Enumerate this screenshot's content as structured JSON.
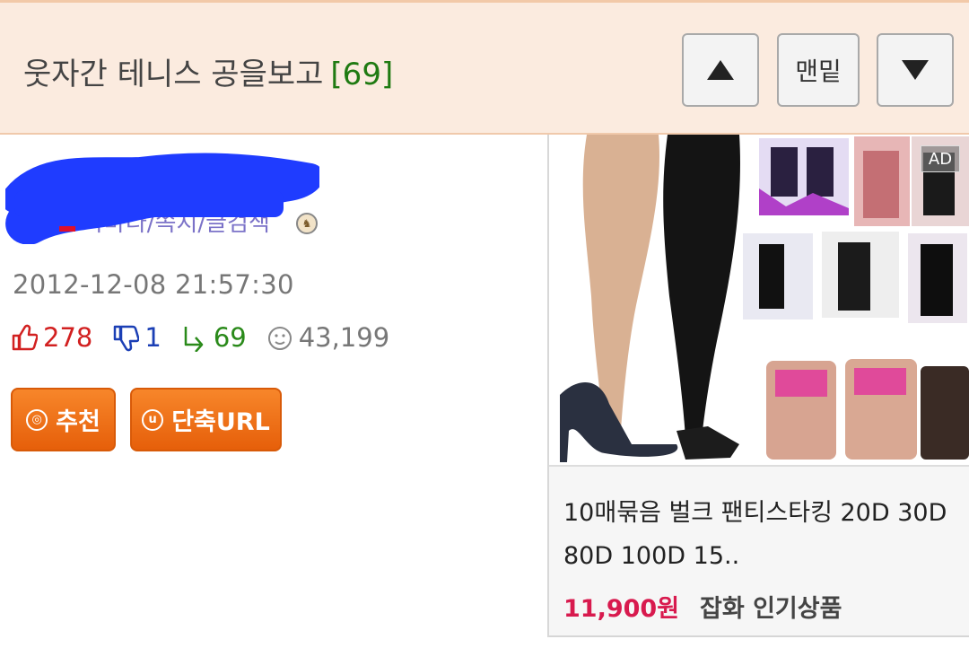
{
  "header": {
    "title": "웃자간 테니스 공을보고",
    "comment_count": "[69]",
    "bottom_label": "맨밑",
    "up_icon": "arrow-up-icon",
    "down_icon": "arrow-down-icon"
  },
  "post": {
    "author_links": "아바타/쪽지/글검색",
    "date": "2012-12-08 21:57:30",
    "stats": {
      "upvotes": "278",
      "downvotes": "1",
      "replies": "69",
      "views": "43,199"
    },
    "buttons": {
      "recommend_label": "추천",
      "shorturl_label": "단축URL"
    }
  },
  "ad": {
    "badge": "AD",
    "title": "10매묶음 벌크 팬티스타킹 20D 30D 80D 100D 15..",
    "price": "11,900원",
    "category": "잡화 인기상품"
  },
  "colors": {
    "header_bg": "#fbebdf",
    "accent_orange": "#ef7017",
    "upvote_red": "#d22020",
    "downvote_blue": "#1b3fb5",
    "reply_green": "#2a8a1a",
    "price_red": "#d81a4e",
    "redaction_blue": "#1f3cff"
  }
}
